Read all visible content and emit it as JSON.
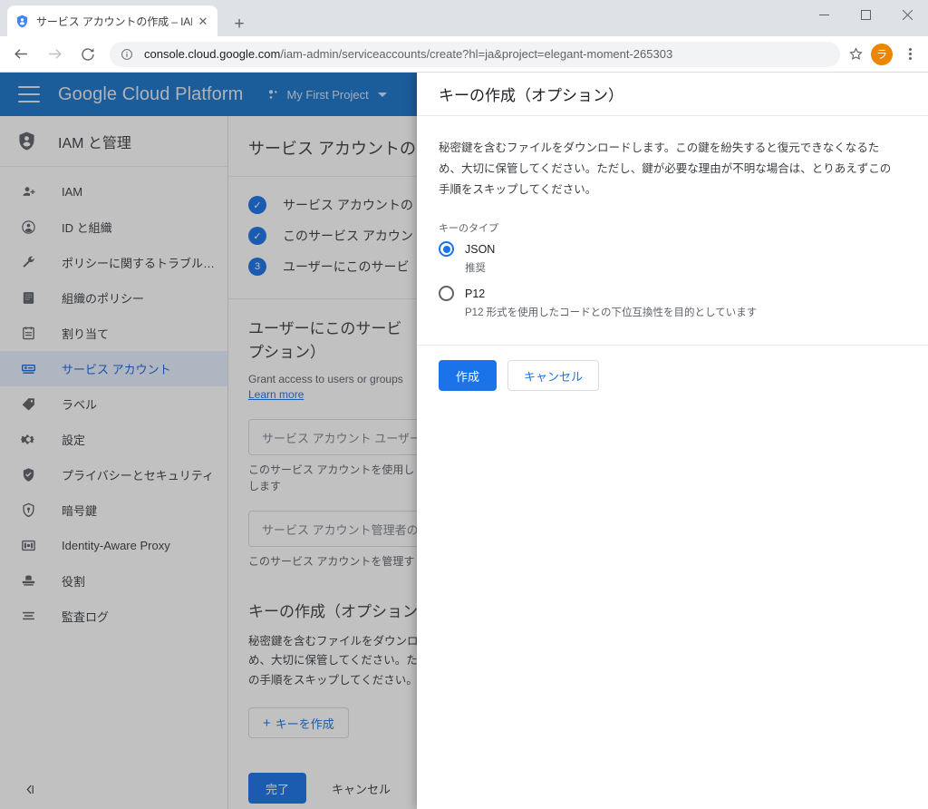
{
  "browser": {
    "tab": {
      "title": "サービス アカウントの作成 – IAM と管",
      "close_label": "✕",
      "favicon_name": "service-account-shield-icon"
    },
    "newtab_label": "+",
    "window": {
      "minimize": "minimize-icon",
      "maximize": "maximize-icon",
      "close": "close-icon"
    },
    "nav": {
      "back": "back-arrow-icon",
      "forward": "forward-arrow-icon",
      "reload": "reload-icon"
    },
    "omnibox": {
      "info_icon": "info-circle-icon",
      "url_host": "console.cloud.google.com",
      "url_path": "/iam-admin/serviceaccounts/create?hl=ja&project=elegant-moment-265303"
    },
    "star_icon": "star-outline-icon",
    "avatar_initial": "ラ",
    "menu_icon": "three-dot-menu-icon"
  },
  "gcp_header": {
    "menu_icon": "hamburger-menu-icon",
    "brand": "Google Cloud Platform",
    "project_name": "My First Project",
    "project_icon": "project-dots-icon",
    "caret_icon": "chevron-down-icon"
  },
  "sidebar": {
    "title": "IAM と管理",
    "title_icon": "iam-shield-icon",
    "collapse_icon": "collapse-panel-icon",
    "items": [
      {
        "label": "IAM",
        "icon": "person-add-icon",
        "active": false
      },
      {
        "label": "ID と組織",
        "icon": "person-circle-icon",
        "active": false
      },
      {
        "label": "ポリシーに関するトラブル…",
        "icon": "wrench-icon",
        "active": false
      },
      {
        "label": "組織のポリシー",
        "icon": "policy-document-icon",
        "active": false
      },
      {
        "label": "割り当て",
        "icon": "quota-calendar-icon",
        "active": false
      },
      {
        "label": "サービス アカウント",
        "icon": "service-account-key-icon",
        "active": true
      },
      {
        "label": "ラベル",
        "icon": "label-tag-icon",
        "active": false
      },
      {
        "label": "設定",
        "icon": "gear-icon",
        "active": false
      },
      {
        "label": "プライバシーとセキュリティ",
        "icon": "shield-check-icon",
        "active": false
      },
      {
        "label": "暗号鍵",
        "icon": "encryption-key-shield-icon",
        "active": false
      },
      {
        "label": "Identity-Aware Proxy",
        "icon": "iap-icon",
        "active": false
      },
      {
        "label": "役割",
        "icon": "roles-icon",
        "active": false
      },
      {
        "label": "監査ログ",
        "icon": "audit-log-icon",
        "active": false
      }
    ]
  },
  "main": {
    "page_title": "サービス アカウントの",
    "steps": [
      {
        "badge": "✓",
        "label": "サービス アカウントの",
        "done": true
      },
      {
        "badge": "✓",
        "label": "このサービス アカウン",
        "done": true
      },
      {
        "badge": "3",
        "label": "ユーザーにこのサービ",
        "done": false
      }
    ],
    "section_grant": {
      "heading": "ユーザーにこのサービ\nプション）",
      "subtext": "Grant access to users or groups",
      "learn_more": "Learn more",
      "field_users_placeholder": "サービス アカウント ユーザー…",
      "field_users_help": "このサービス アカウントを使用し\nします",
      "field_admins_placeholder": "サービス アカウント管理者の役",
      "field_admins_help": "このサービス アカウントを管理す"
    },
    "section_key": {
      "heading": "キーの作成（オプション",
      "body": "秘密鍵を含むファイルをダウンロ\nめ、大切に保管してください。た\nの手順をスキップしてください。",
      "create_key_button": "キーを作成",
      "create_key_plus": "+"
    },
    "actions": {
      "done": "完了",
      "cancel": "キャンセル"
    }
  },
  "dialog": {
    "title": "キーの作成（オプション）",
    "description": "秘密鍵を含むファイルをダウンロードします。この鍵を紛失すると復元できなくなるため、大切に保管してください。ただし、鍵が必要な理由が不明な場合は、とりあえずこの手順をスキップしてください。",
    "group_label": "キーのタイプ",
    "options": [
      {
        "label": "JSON",
        "help": "推奨",
        "selected": true
      },
      {
        "label": "P12",
        "help": "P12 形式を使用したコードとの下位互換性を目的としています",
        "selected": false
      }
    ],
    "create_button": "作成",
    "cancel_button": "キャンセル"
  },
  "colors": {
    "brand_blue": "#1a73e8",
    "header_blue": "#1a73c8",
    "accent_orange": "#ea8600",
    "active_nav_bg": "#e8f0fe"
  }
}
